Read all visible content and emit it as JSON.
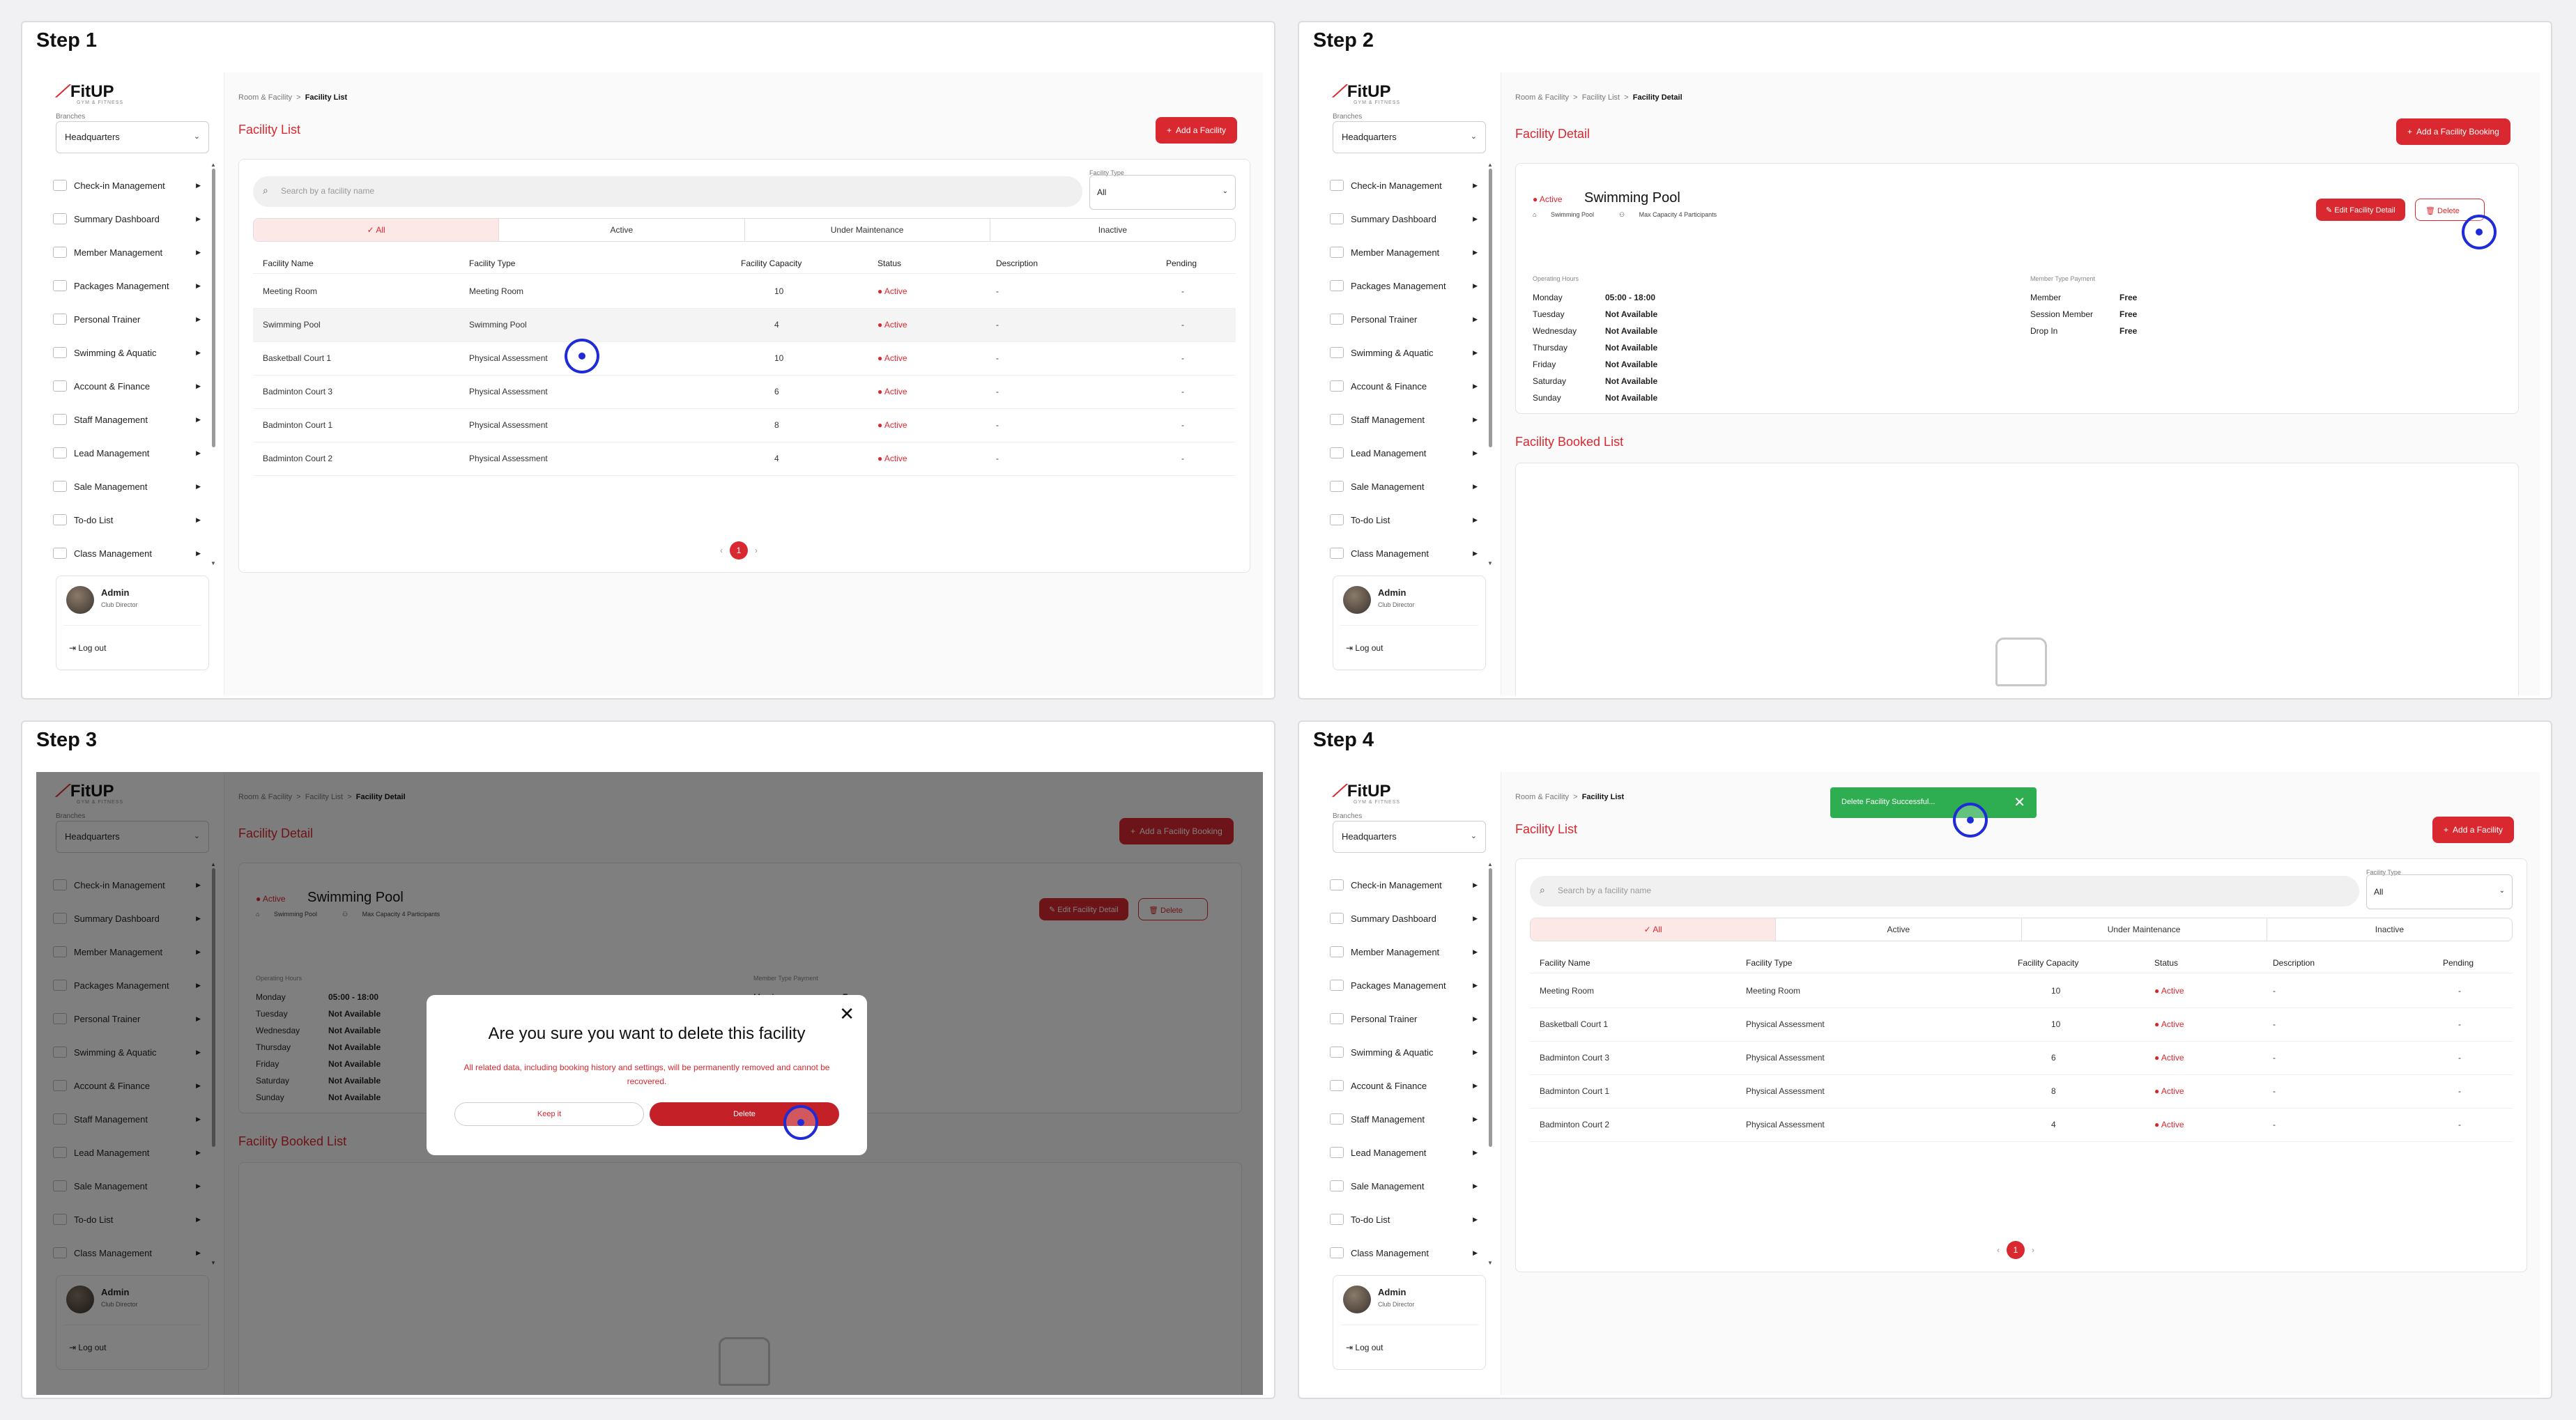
{
  "steps": [
    {
      "label": "Step 1"
    },
    {
      "label": "Step 2"
    },
    {
      "label": "Step 3"
    },
    {
      "label": "Step 4"
    }
  ],
  "app": {
    "brand": "FitUP",
    "brand_sub": "GYM & FITNESS",
    "branch_label": "Branches",
    "branch_value": "Headquarters",
    "menu": [
      "Check-in Management",
      "Summary Dashboard",
      "Member Management",
      "Packages Management",
      "Personal Trainer",
      "Swimming & Aquatic",
      "Account & Finance",
      "Staff Management",
      "Lead Management",
      "Sale Management",
      "To-do List",
      "Class Management"
    ],
    "user_name": "Admin",
    "user_role": "Club Director",
    "logout": "Log out"
  },
  "list": {
    "crumb_root": "Room & Facility",
    "crumb_current": "Facility List",
    "title": "Facility List",
    "add_button": "Add a Facility",
    "search_placeholder": "Search by a facility name",
    "type_label": "Facility Type",
    "type_value": "All",
    "tabs": [
      "All",
      "Active",
      "Under Maintenance",
      "Inactive"
    ],
    "columns": [
      "Facility Name",
      "Facility Type",
      "Facility Capacity",
      "Status",
      "Description",
      "Pending"
    ],
    "rows_step1": [
      [
        "Meeting Room",
        "Meeting Room",
        "10",
        "Active",
        "-",
        "-"
      ],
      [
        "Swimming Pool",
        "Swimming Pool",
        "4",
        "Active",
        "-",
        "-"
      ],
      [
        "Basketball Court 1",
        "Physical Assessment",
        "10",
        "Active",
        "-",
        "-"
      ],
      [
        "Badminton Court 3",
        "Physical Assessment",
        "6",
        "Active",
        "-",
        "-"
      ],
      [
        "Badminton Court 1",
        "Physical Assessment",
        "8",
        "Active",
        "-",
        "-"
      ],
      [
        "Badminton Court 2",
        "Physical Assessment",
        "4",
        "Active",
        "-",
        "-"
      ]
    ],
    "rows_step4": [
      [
        "Meeting Room",
        "Meeting Room",
        "10",
        "Active",
        "-",
        "-"
      ],
      [
        "Basketball Court 1",
        "Physical Assessment",
        "10",
        "Active",
        "-",
        "-"
      ],
      [
        "Badminton Court 3",
        "Physical Assessment",
        "6",
        "Active",
        "-",
        "-"
      ],
      [
        "Badminton Court 1",
        "Physical Assessment",
        "8",
        "Active",
        "-",
        "-"
      ],
      [
        "Badminton Court 2",
        "Physical Assessment",
        "4",
        "Active",
        "-",
        "-"
      ]
    ],
    "page": "1",
    "prev": "‹",
    "next": "›"
  },
  "detail": {
    "crumb_root": "Room & Facility",
    "crumb_mid": "Facility List",
    "crumb_current": "Facility Detail",
    "title": "Facility Detail",
    "add_booking": "Add a Facility Booking",
    "status": "Active",
    "name": "Swimming Pool",
    "type": "Swimming Pool",
    "capacity": "Max Capacity 4 Participants",
    "edit_button": "Edit Facility Detail",
    "delete_button": "Delete",
    "hours_label": "Operating Hours",
    "hours": [
      [
        "Monday",
        "05:00 - 18:00"
      ],
      [
        "Tuesday",
        "Not Available"
      ],
      [
        "Wednesday",
        "Not Available"
      ],
      [
        "Thursday",
        "Not Available"
      ],
      [
        "Friday",
        "Not Available"
      ],
      [
        "Saturday",
        "Not Available"
      ],
      [
        "Sunday",
        "Not Available"
      ]
    ],
    "payment_label": "Member Type Payment",
    "payments": [
      [
        "Member",
        "Free"
      ],
      [
        "Session Member",
        "Free"
      ],
      [
        "Drop In",
        "Free"
      ]
    ],
    "booked_title": "Facility Booked List"
  },
  "modal": {
    "title": "Are you sure you want to delete this facility",
    "desc": "All related data, including booking history and settings, will be permanently removed and cannot be recovered.",
    "keep": "Keep it",
    "delete": "Delete"
  },
  "toast": {
    "text": "Delete Facility Successful..."
  },
  "colors": {
    "accent": "#d9282f",
    "success": "#2fae51",
    "cursor": "#1e2bd6"
  }
}
